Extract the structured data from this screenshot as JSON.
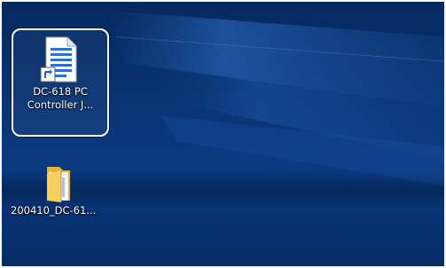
{
  "desktop": {
    "icons": [
      {
        "label": "DC-618 PC\nController J...",
        "icon": "document-shortcut-icon",
        "selected": true
      },
      {
        "label": "200410_DC-61...",
        "icon": "folder-icon",
        "selected": false
      }
    ]
  }
}
